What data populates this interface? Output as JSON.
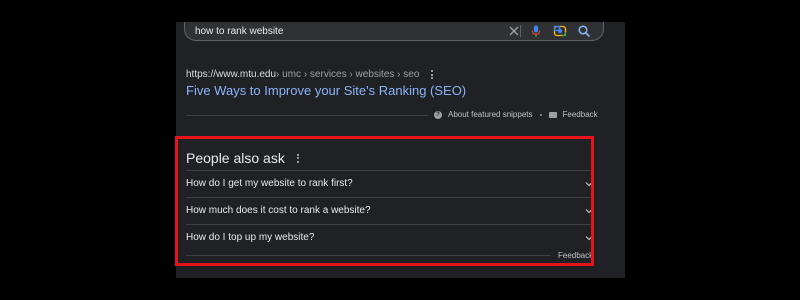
{
  "search": {
    "query": "how to rank website",
    "icons": [
      "close-icon",
      "mic-icon",
      "camera-icon",
      "search-icon"
    ]
  },
  "result": {
    "url": "https://www.mtu.edu",
    "breadcrumb": " › umc › services › websites › seo",
    "title": "Five Ways to Improve your Site's Ranking (SEO)"
  },
  "snippet_footer": {
    "about_label": "About featured snippets",
    "feedback_label": "Feedback"
  },
  "paa": {
    "heading": "People also ask",
    "questions": [
      "How do I get my website to rank first?",
      "How much does it cost to rank a website?",
      "How do I top up my website?"
    ],
    "feedback_label": "Feedback"
  },
  "colors": {
    "background": "#000000",
    "panel": "#202124",
    "link": "#8ab4f8",
    "highlight": "#e8131a"
  }
}
